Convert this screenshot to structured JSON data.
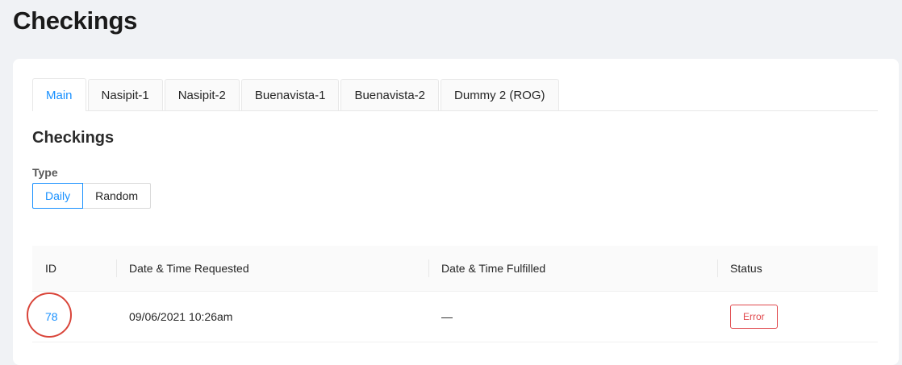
{
  "header": {
    "title": "Checkings"
  },
  "tabs": [
    {
      "label": "Main",
      "active": true
    },
    {
      "label": "Nasipit-1",
      "active": false
    },
    {
      "label": "Nasipit-2",
      "active": false
    },
    {
      "label": "Buenavista-1",
      "active": false
    },
    {
      "label": "Buenavista-2",
      "active": false
    },
    {
      "label": "Dummy 2 (ROG)",
      "active": false
    }
  ],
  "section": {
    "title": "Checkings",
    "type_label": "Type",
    "type_options": [
      {
        "label": "Daily",
        "selected": true
      },
      {
        "label": "Random",
        "selected": false
      }
    ]
  },
  "table": {
    "columns": {
      "id": "ID",
      "requested": "Date & Time Requested",
      "fulfilled": "Date & Time Fulfilled",
      "status": "Status"
    },
    "rows": [
      {
        "id": "78",
        "requested": "09/06/2021 10:26am",
        "fulfilled": "—",
        "status": "Error"
      }
    ]
  },
  "colors": {
    "accent": "#1890ff",
    "error": "#e0494d",
    "highlight_circle": "#d9453a"
  }
}
